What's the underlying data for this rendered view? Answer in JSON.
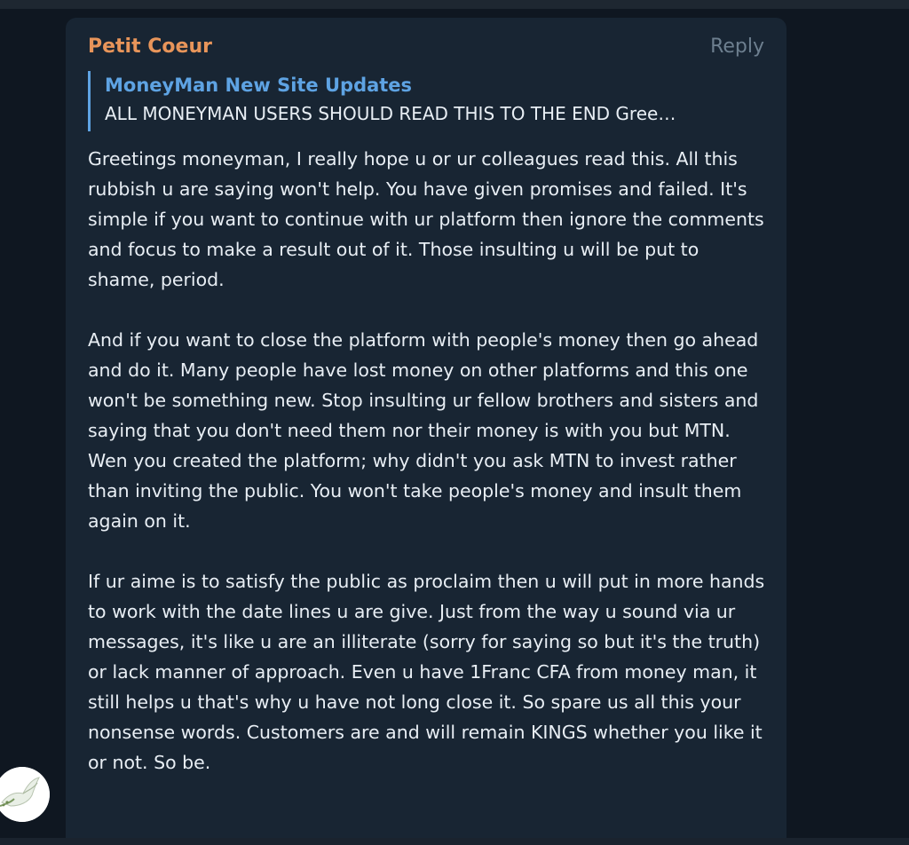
{
  "message": {
    "sender": "Petit Coeur",
    "reply_label": "Reply",
    "quote": {
      "title": "MoneyMan New Site Updates",
      "text": "ALL MONEYMAN USERS SHOULD READ THIS TO THE END  Gree…"
    },
    "paragraphs": [
      "Greetings moneyman, I really hope u or ur colleagues read this. All this rubbish u are saying won't help. You have given promises and failed. It's simple if you want to continue with ur platform then ignore the comments and focus to make a result out of it. Those insulting u will be put to shame, period.",
      "And if you want to close the platform with people's money then go ahead and do it. Many people have lost money on other platforms and this one won't be something new. Stop insulting ur fellow brothers and sisters and saying that you don't need them nor their money is with you but MTN. Wen you created the platform; why didn't you ask MTN to invest rather than inviting the public. You won't take people's money and insult them again on it.",
      "If ur aime is to satisfy the public as proclaim then u will put in more hands to work with the date lines u are give. Just from the way u sound via ur messages, it's like u are an illiterate (sorry for saying so but it's the truth) or lack manner of approach. Even u have 1Franc CFA from money man, it still helps u that's why u have not long close it. So spare us all this your nonsense words. Customers are and will remain KINGS whether you like it or not. So be."
    ]
  },
  "colors": {
    "background": "#0f1721",
    "bubble": "#182533",
    "sender": "#e8955a",
    "quote_accent": "#5ea3e3",
    "text": "#e8eef4",
    "reply": "#6d7f8f"
  },
  "avatar": {
    "icon": "dove-icon"
  }
}
